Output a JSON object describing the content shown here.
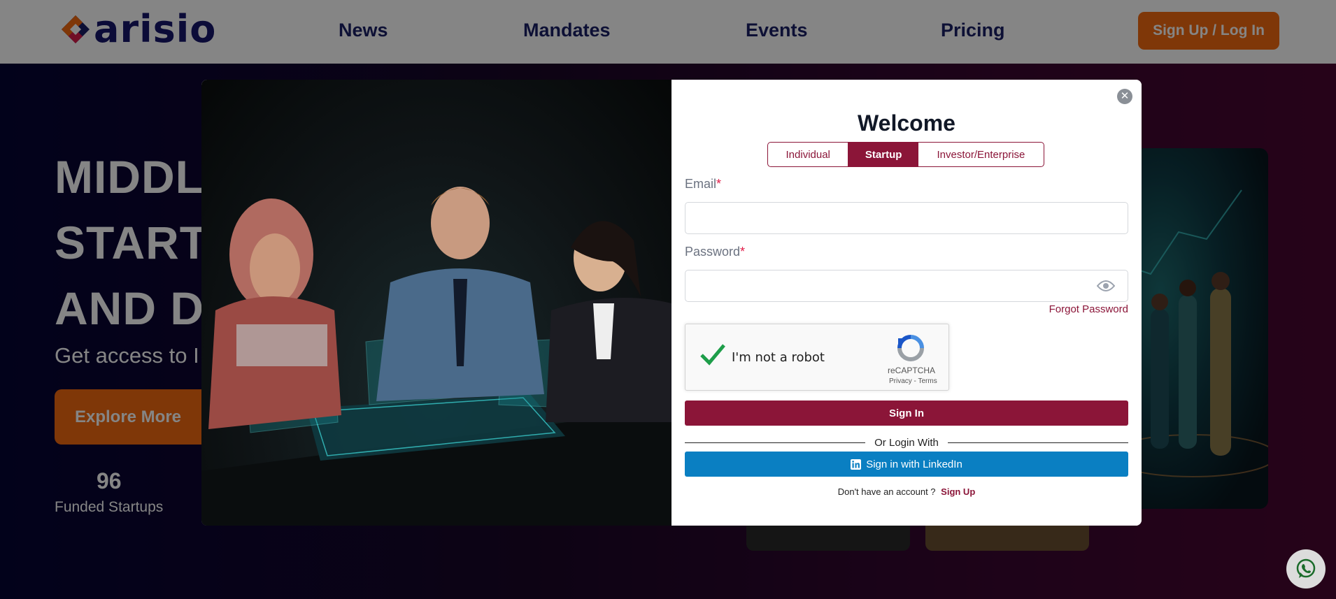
{
  "navbar": {
    "logo_text": "arisio",
    "links": [
      "News",
      "Mandates",
      "Events",
      "Pricing"
    ],
    "cta_label": "Sign Up / Log In"
  },
  "hero": {
    "lines": [
      "MIDDLE",
      "START",
      "AND DA"
    ],
    "subtitle": "Get access to I",
    "explore_label": "Explore More",
    "stat_value": "96",
    "stat_label": "Funded Startups"
  },
  "modal": {
    "title": "Welcome",
    "tabs": [
      {
        "label": "Individual",
        "active": false
      },
      {
        "label": "Startup",
        "active": true
      },
      {
        "label": "Investor/Enterprise",
        "active": false
      }
    ],
    "email_label": "Email",
    "password_label": "Password",
    "required_mark": "*",
    "forgot_password": "Forgot Password",
    "captcha": {
      "label": "I'm not a robot",
      "brand": "reCAPTCHA",
      "links": "Privacy - Terms",
      "checked": true
    },
    "signin_label": "Sign In",
    "divider_text": "Or Login With",
    "linkedin_label": "Sign in with LinkedIn",
    "no_account_text": "Don't have an account ?",
    "signup_link": "Sign Up"
  },
  "colors": {
    "brand_maroon": "#8b1538",
    "brand_orange": "#f36a10",
    "nav_text": "#1a1f66",
    "linkedin_blue": "#0a7fc2"
  },
  "icons": [
    "close-icon",
    "eye-icon",
    "recaptcha-icon",
    "linkedin-icon",
    "whatsapp-icon",
    "checkmark-icon"
  ]
}
